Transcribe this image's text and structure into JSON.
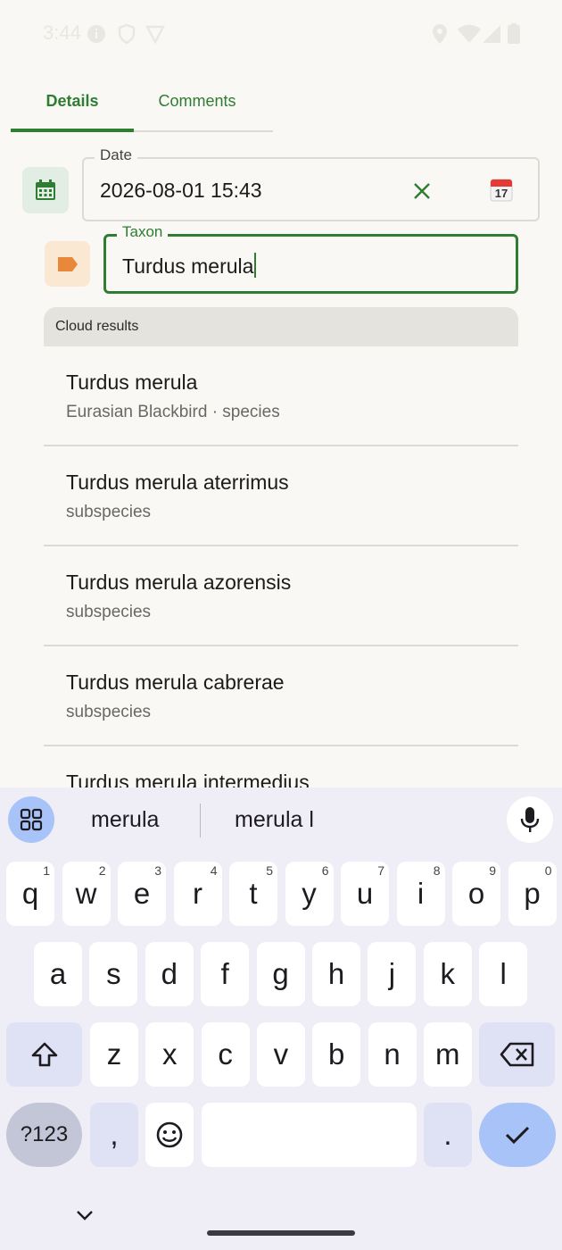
{
  "status_bar": {
    "time": "3:44"
  },
  "tabs": [
    {
      "label": "Details",
      "active": true
    },
    {
      "label": "Comments",
      "active": false
    }
  ],
  "date_field": {
    "label": "Date",
    "value": "2026-08-01 15:43",
    "calendar_badge": "17"
  },
  "taxon_field": {
    "label": "Taxon",
    "value": "Turdus merula"
  },
  "results": {
    "header": "Cloud results",
    "items": [
      {
        "name": "Turdus merula",
        "sub": "Eurasian Blackbird · species"
      },
      {
        "name": "Turdus merula aterrimus",
        "sub": "subspecies"
      },
      {
        "name": "Turdus merula azorensis",
        "sub": "subspecies"
      },
      {
        "name": "Turdus merula cabrerae",
        "sub": "subspecies"
      },
      {
        "name": "Turdus merula intermedius",
        "sub": ""
      }
    ]
  },
  "keyboard": {
    "suggestions": [
      "merula",
      "merula l"
    ],
    "row1": [
      {
        "k": "q",
        "h": "1"
      },
      {
        "k": "w",
        "h": "2"
      },
      {
        "k": "e",
        "h": "3"
      },
      {
        "k": "r",
        "h": "4"
      },
      {
        "k": "t",
        "h": "5"
      },
      {
        "k": "y",
        "h": "6"
      },
      {
        "k": "u",
        "h": "7"
      },
      {
        "k": "i",
        "h": "8"
      },
      {
        "k": "o",
        "h": "9"
      },
      {
        "k": "p",
        "h": "0"
      }
    ],
    "row2": [
      "a",
      "s",
      "d",
      "f",
      "g",
      "h",
      "j",
      "k",
      "l"
    ],
    "row3": [
      "z",
      "x",
      "c",
      "v",
      "b",
      "n",
      "m"
    ],
    "symbols_label": "?123",
    "comma": ",",
    "period": "."
  },
  "colors": {
    "accent": "#2e7d32",
    "tag": "#e8883a",
    "background": "#faf8f4",
    "keyboard_bg": "#efedf6"
  }
}
